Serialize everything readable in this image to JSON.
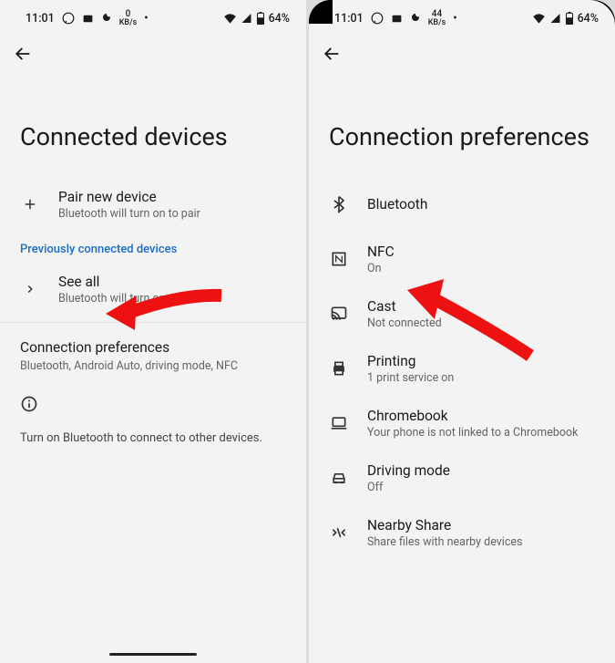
{
  "left": {
    "status": {
      "time": "11:01",
      "speed_top": "0",
      "speed_bot": "KB/s",
      "battery": "64%"
    },
    "title": "Connected devices",
    "pair": {
      "label": "Pair new device",
      "sub": "Bluetooth will turn on to pair"
    },
    "prev_section": "Previously connected devices",
    "see_all": {
      "label": "See all",
      "sub": "Bluetooth will turn on"
    },
    "conn_pref": {
      "title": "Connection preferences",
      "sub": "Bluetooth, Android Auto, driving mode, NFC"
    },
    "info": "Turn on Bluetooth to connect to other devices."
  },
  "right": {
    "status": {
      "time": "11:01",
      "speed_top": "44",
      "speed_bot": "KB/s",
      "battery": "64%"
    },
    "title": "Connection preferences",
    "items": [
      {
        "label": "Bluetooth",
        "sub": ""
      },
      {
        "label": "NFC",
        "sub": "On"
      },
      {
        "label": "Cast",
        "sub": "Not connected"
      },
      {
        "label": "Printing",
        "sub": "1 print service on"
      },
      {
        "label": "Chromebook",
        "sub": "Your phone is not linked to a Chromebook"
      },
      {
        "label": "Driving mode",
        "sub": "Off"
      },
      {
        "label": "Nearby Share",
        "sub": "Share files with nearby devices"
      }
    ]
  }
}
